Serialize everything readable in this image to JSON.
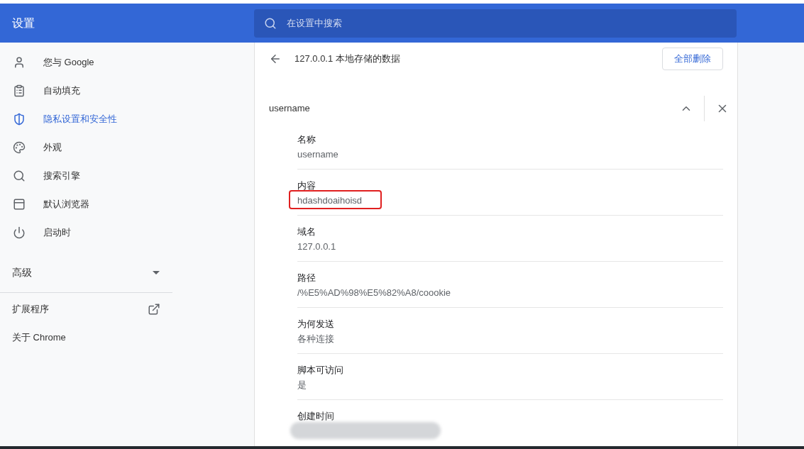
{
  "header": {
    "title": "设置",
    "search": {
      "placeholder": "在设置中搜索"
    }
  },
  "sidebar": {
    "items": [
      {
        "label": "您与 Google",
        "selected": false
      },
      {
        "label": "自动填充",
        "selected": false
      },
      {
        "label": "隐私设置和安全性",
        "selected": true
      },
      {
        "label": "外观",
        "selected": false
      },
      {
        "label": "搜索引擎",
        "selected": false
      },
      {
        "label": "默认浏览器",
        "selected": false
      },
      {
        "label": "启动时",
        "selected": false
      }
    ],
    "advanced": {
      "label": "高级",
      "expanded": false
    },
    "links": [
      {
        "label": "扩展程序",
        "external": true
      },
      {
        "label": "关于 Chrome",
        "external": false
      }
    ]
  },
  "page": {
    "title": "127.0.0.1 本地存储的数据",
    "delete_all": "全部删除",
    "cookie": {
      "name": "username",
      "expanded": true,
      "fields": [
        {
          "label": "名称",
          "value": "username",
          "highlighted": false,
          "redacted": false
        },
        {
          "label": "内容",
          "value": "hdashdoaihoisd",
          "highlighted": true,
          "redacted": false
        },
        {
          "label": "域名",
          "value": "127.0.0.1",
          "highlighted": false,
          "redacted": false
        },
        {
          "label": "路径",
          "value": "/%E5%AD%98%E5%82%A8/coookie",
          "highlighted": false,
          "redacted": false
        },
        {
          "label": "为何发送",
          "value": "各种连接",
          "highlighted": false,
          "redacted": false
        },
        {
          "label": "脚本可访问",
          "value": "是",
          "highlighted": false,
          "redacted": false
        },
        {
          "label": "创建时间",
          "highlighted": false,
          "redacted": true
        }
      ]
    }
  }
}
